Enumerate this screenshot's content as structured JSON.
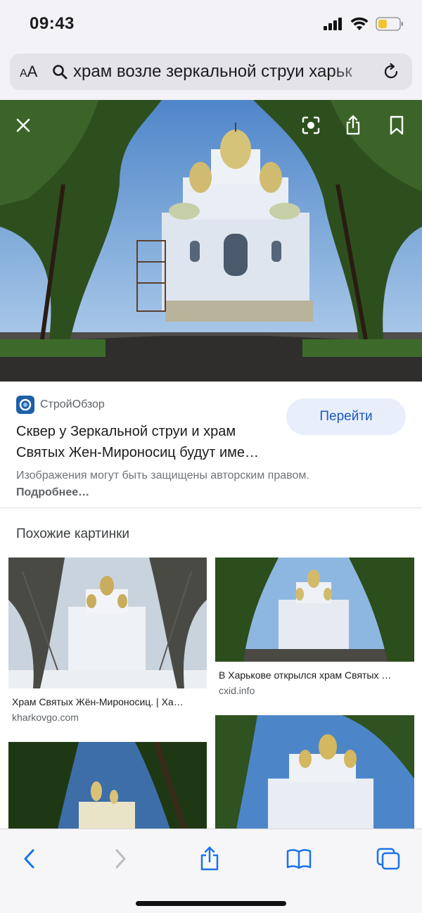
{
  "status_bar": {
    "time": "09:43",
    "icons": [
      "signal-icon",
      "wifi-icon",
      "battery-icon"
    ],
    "battery_color": "#f4c430"
  },
  "address_bar": {
    "text_size_label_small": "A",
    "text_size_label_large": "A",
    "query": "храм возле зеркальной струи харьк",
    "icons": [
      "search-icon",
      "reload-icon"
    ]
  },
  "viewer": {
    "buttons": [
      "close-icon",
      "lens-icon",
      "share-icon",
      "bookmark-icon"
    ]
  },
  "result": {
    "source_name": "СтройОбзор",
    "title": "Сквер у Зеркальной струи и храм Святых Жен-Мироносиц будут име…",
    "go_button": "Перейти",
    "copyright_text": "Изображения могут быть защищены авторским правом.",
    "more_link": "Подробнее…"
  },
  "similar": {
    "heading": "Похожие картинки",
    "items": [
      {
        "caption": "Храм Святых Жён-Мироносиц. | Ха…",
        "domain": "kharkovgo.com"
      },
      {
        "caption": "В Харькове открылся храм Святых …",
        "domain": "cxid.info"
      },
      {
        "caption": "",
        "domain": ""
      },
      {
        "caption": "",
        "domain": ""
      }
    ]
  },
  "toolbar": {
    "buttons": [
      "back-icon",
      "forward-icon",
      "share-icon",
      "bookmarks-icon",
      "tabs-icon"
    ],
    "accent_color": "#1a73e8"
  }
}
